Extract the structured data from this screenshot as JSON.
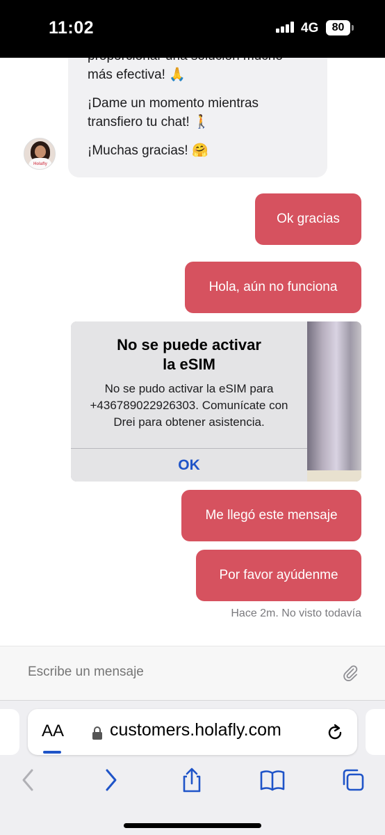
{
  "status_bar": {
    "time": "11:02",
    "network": "4G",
    "battery": "80"
  },
  "chat": {
    "agent_message": {
      "lines": [
        "proporcionar una solución mucho más efectiva! 🙏",
        "¡Dame un momento mientras transfiero tu chat! 🚶",
        "¡Muchas gracias! 🤗"
      ]
    },
    "avatar_label": "Holafly",
    "user_messages": [
      "Ok gracias",
      "Hola, aún no funciona",
      "Me llegó este mensaje",
      "Por favor ayúdenme"
    ],
    "screenshot_alert": {
      "title_line1": "No se puede activar",
      "title_line2": "la eSIM",
      "body": "No se pudo activar la eSIM para +436789022926303. Comunícate con Drei para obtener asistencia.",
      "button": "OK"
    },
    "status": "Hace 2m. No visto todavía"
  },
  "composer": {
    "placeholder": "Escribe un mensaje"
  },
  "browser": {
    "text_size_label": "AA",
    "url": "customers.holafly.com"
  }
}
